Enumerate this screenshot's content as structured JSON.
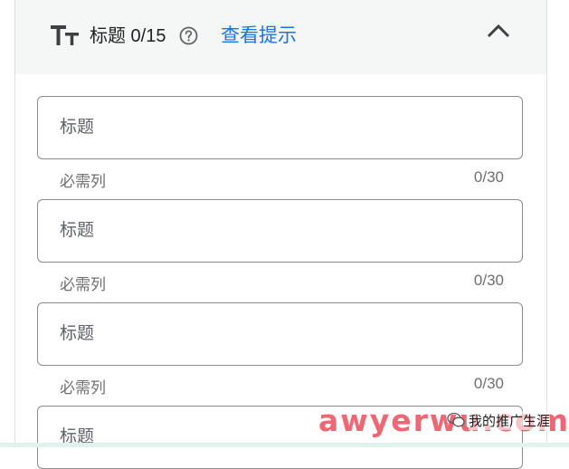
{
  "header": {
    "title": "标题 0/15",
    "hint_link": "查看提示"
  },
  "fields": [
    {
      "placeholder": "标题",
      "helper": "必需列",
      "counter": "0/30"
    },
    {
      "placeholder": "标题",
      "helper": "必需列",
      "counter": "0/30"
    },
    {
      "placeholder": "标题",
      "helper": "必需列",
      "counter": "0/30"
    },
    {
      "placeholder": "标题"
    }
  ],
  "watermark": {
    "site": "awyerwu.com",
    "account": "我的推广生涯"
  },
  "colors": {
    "link": "#1a73e8",
    "header_bg": "#f5f7f6",
    "field_border": "#8c8c8c",
    "helper_text": "#6f6f6f",
    "watermark": "#f04b5a"
  },
  "icons": [
    "text-size-icon",
    "help-circle-icon",
    "chevron-up-icon",
    "wechat-icon"
  ]
}
